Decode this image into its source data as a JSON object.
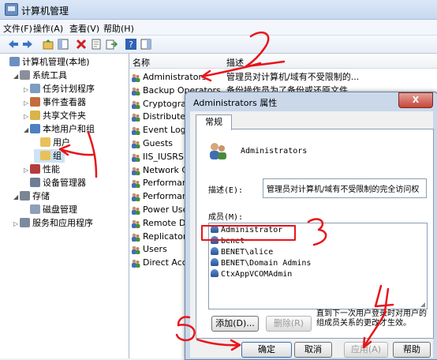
{
  "window": {
    "title": "计算机管理"
  },
  "menu": [
    "文件(F)",
    "操作(A)",
    "查看(V)",
    "帮助(H)"
  ],
  "tree": [
    {
      "label": "计算机管理(本地)",
      "level": 0,
      "icon": "computer-icon",
      "expander": ""
    },
    {
      "label": "系统工具",
      "level": 1,
      "icon": "tools-icon",
      "expander": "◢"
    },
    {
      "label": "任务计划程序",
      "level": 2,
      "icon": "clock-icon",
      "expander": "▷"
    },
    {
      "label": "事件查看器",
      "level": 2,
      "icon": "event-viewer-icon",
      "expander": "▷"
    },
    {
      "label": "共享文件夹",
      "level": 2,
      "icon": "shared-folder-icon",
      "expander": "▷"
    },
    {
      "label": "本地用户和组",
      "level": 2,
      "icon": "users-icon",
      "expander": "◢"
    },
    {
      "label": "用户",
      "level": 3,
      "icon": "folder-icon",
      "expander": ""
    },
    {
      "label": "组",
      "level": 3,
      "icon": "folder-icon",
      "expander": "",
      "selected": true
    },
    {
      "label": "性能",
      "level": 2,
      "icon": "performance-icon",
      "expander": "▷"
    },
    {
      "label": "设备管理器",
      "level": 2,
      "icon": "device-manager-icon",
      "expander": ""
    },
    {
      "label": "存储",
      "level": 1,
      "icon": "storage-icon",
      "expander": "◢"
    },
    {
      "label": "磁盘管理",
      "level": 2,
      "icon": "disk-icon",
      "expander": ""
    },
    {
      "label": "服务和应用程序",
      "level": 1,
      "icon": "services-icon",
      "expander": "▷"
    }
  ],
  "list": {
    "col_name": "名称",
    "col_desc": "描述",
    "rows": [
      {
        "name": "Administrators",
        "desc": "管理员对计算机/域有不受限制的..."
      },
      {
        "name": "Backup Operators",
        "desc": "备份操作员为了备份或还原文件..."
      },
      {
        "name": "Cryptographic Operators",
        "desc": ""
      },
      {
        "name": "Distributed COM Users",
        "desc": ""
      },
      {
        "name": "Event Log Readers",
        "desc": ""
      },
      {
        "name": "Guests",
        "desc": ""
      },
      {
        "name": "IIS_IUSRS",
        "desc": ""
      },
      {
        "name": "Network Configuration Operators",
        "desc": ""
      },
      {
        "name": "Performance Log Users",
        "desc": ""
      },
      {
        "name": "Performance Monitor Users",
        "desc": ""
      },
      {
        "name": "Power Users",
        "desc": ""
      },
      {
        "name": "Remote Desktop Users",
        "desc": ""
      },
      {
        "name": "Replicator",
        "desc": ""
      },
      {
        "name": "Users",
        "desc": ""
      },
      {
        "name": "Direct Access",
        "desc": ""
      }
    ]
  },
  "dialog": {
    "title": "Administrators 属性",
    "close": "X",
    "tab": "常规",
    "group_name": "Administrators",
    "desc_label": "描述(E):",
    "desc_value": "管理员对计算机/域有不受限制的完全访问权",
    "members_label": "成员(M):",
    "members": [
      "Administrator",
      "benet",
      "BENET\\alice",
      "BENET\\Domain Admins",
      "CtxAppVCOMAdmin"
    ],
    "add_button": "添加(D)...",
    "remove_button": "删除(R)",
    "note": "直到下一次用户登录时对用户的组成员关系的更改才生效。",
    "ok": "确定",
    "cancel": "取消",
    "apply": "应用(A)",
    "help": "帮助"
  },
  "annotations": [
    "1",
    "2",
    "3",
    "4",
    "5"
  ],
  "colors": {
    "annotation": "#e8141b",
    "selection": "#cde3f8"
  }
}
